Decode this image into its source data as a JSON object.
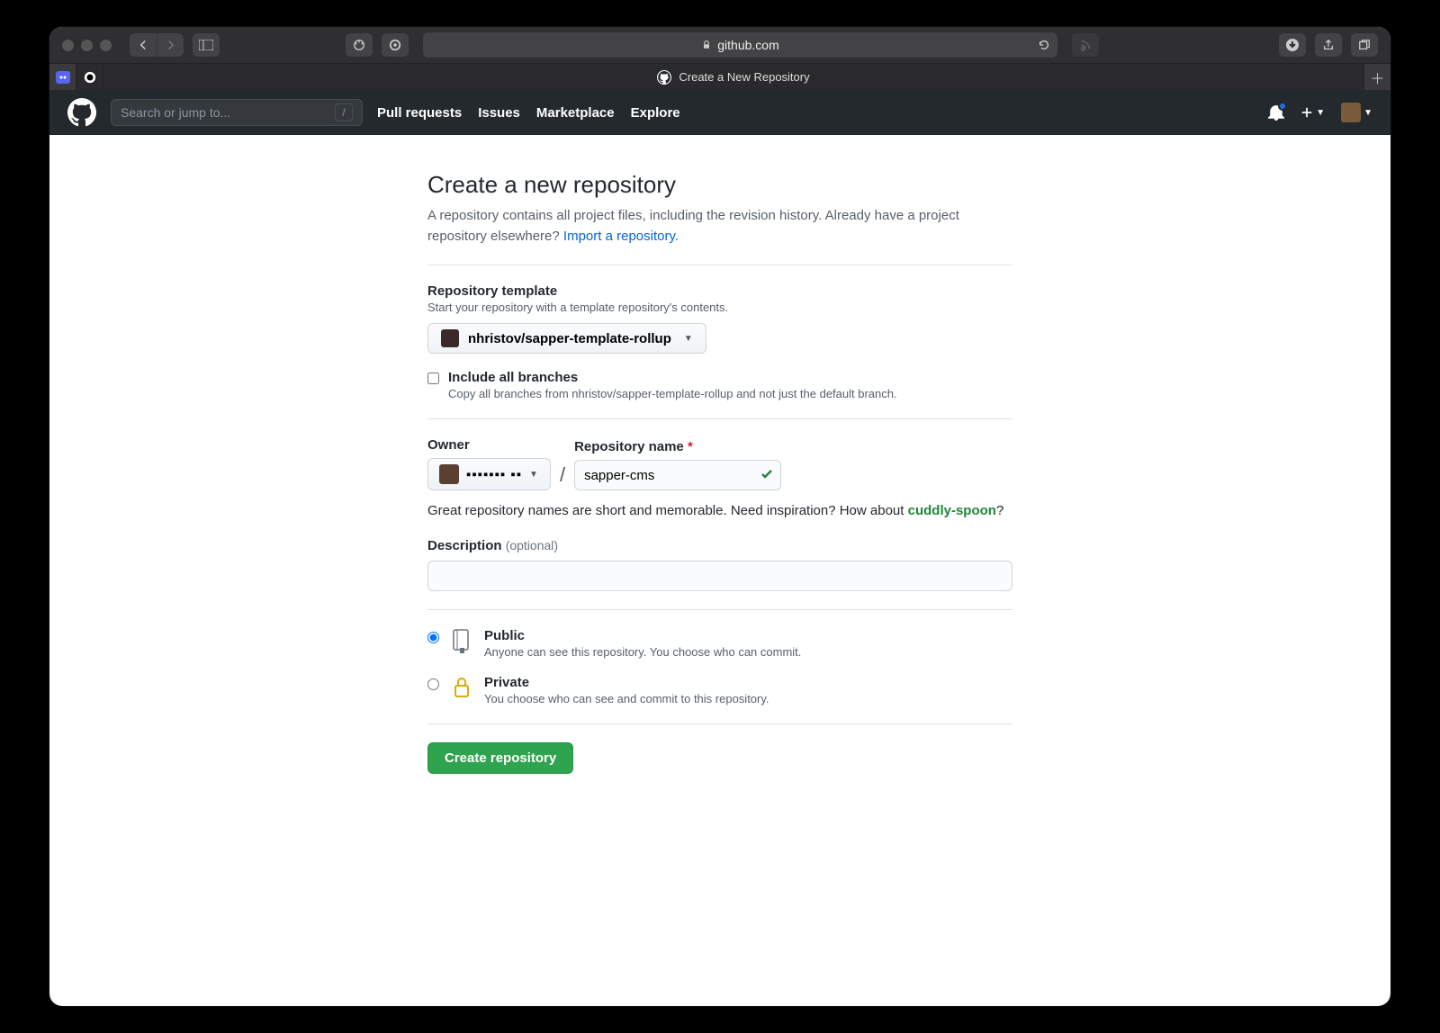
{
  "browser": {
    "url_host": "github.com",
    "tab_title": "Create a New Repository"
  },
  "header": {
    "search_placeholder": "Search or jump to...",
    "slash": "/",
    "nav": {
      "pulls": "Pull requests",
      "issues": "Issues",
      "marketplace": "Marketplace",
      "explore": "Explore"
    }
  },
  "page": {
    "title": "Create a new repository",
    "lead_1": "A repository contains all project files, including the revision history. Already have a project repository elsewhere? ",
    "lead_link": "Import a repository.",
    "template": {
      "label": "Repository template",
      "sub": "Start your repository with a template repository's contents.",
      "selected": "nhristov/sapper-template-rollup"
    },
    "include": {
      "title": "Include all branches",
      "sub": "Copy all branches from nhristov/sapper-template-rollup and not just the default branch."
    },
    "owner_label": "Owner",
    "owner_value": "▪▪▪▪▪▪▪ ▪▪",
    "repo_label": "Repository name",
    "repo_value": "sapper-cms",
    "hint_pre": "Great repository names are short and memorable. Need inspiration? How about ",
    "hint_sugg": "cuddly-spoon",
    "hint_post": "?",
    "desc_label": "Description",
    "desc_opt": "(optional)",
    "visibility": {
      "public": {
        "title": "Public",
        "sub": "Anyone can see this repository. You choose who can commit."
      },
      "private": {
        "title": "Private",
        "sub": "You choose who can see and commit to this repository."
      }
    },
    "submit": "Create repository"
  }
}
